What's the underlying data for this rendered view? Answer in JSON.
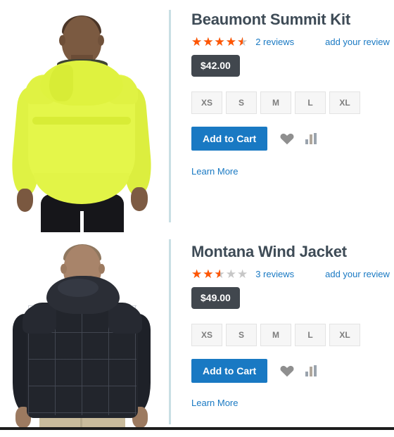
{
  "products": [
    {
      "name": "Beaumont Summit Kit",
      "rating_percent": 90,
      "rating_stars": "★★★★★",
      "reviews_label": "2 reviews",
      "add_review_label": "add your review",
      "price": "$42.00",
      "sizes": [
        "XS",
        "S",
        "M",
        "L",
        "XL"
      ],
      "add_to_cart_label": "Add to Cart",
      "wishlist_icon": "heart-icon",
      "compare_icon": "compare-bar-chart-icon",
      "learn_more_label": "Learn More",
      "image_alt": "Man seen from behind wearing a neon yellow hooded windbreaker jacket"
    },
    {
      "name": "Montana Wind Jacket",
      "rating_percent": 50,
      "rating_stars": "★★★★★",
      "reviews_label": "3 reviews",
      "add_review_label": "add your review",
      "price": "$49.00",
      "sizes": [
        "XS",
        "S",
        "M",
        "L",
        "XL"
      ],
      "add_to_cart_label": "Add to Cart",
      "wishlist_icon": "heart-icon",
      "compare_icon": "compare-bar-chart-icon",
      "learn_more_label": "Learn More",
      "image_alt": "Man seen from behind wearing a dark navy quilted puffer jacket with khaki pants"
    }
  ],
  "colors": {
    "link": "#1979c3",
    "star_filled": "#ff5501",
    "star_empty": "#c7c7c7",
    "price_badge_bg": "#41474e",
    "button_bg": "#1979c3",
    "title": "#3e4b56",
    "divider": "#c9dfe4",
    "swatch_bg": "#f6f6f6",
    "icon_gray": "#8f8f8f"
  }
}
